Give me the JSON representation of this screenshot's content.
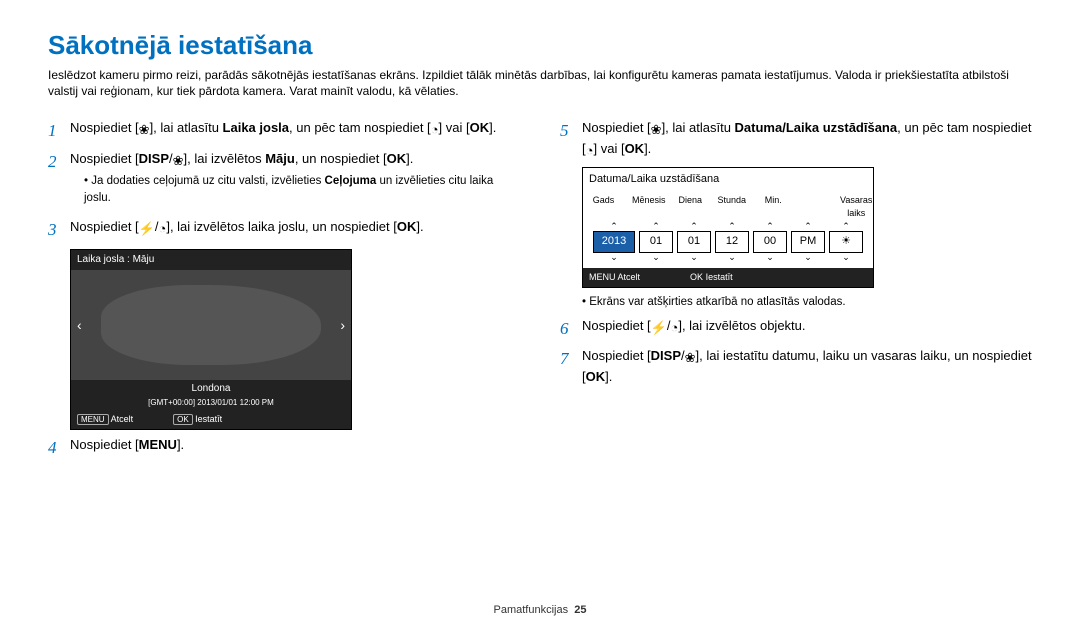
{
  "title": "Sākotnējā iestatīšana",
  "intro": "Ieslēdzot kameru pirmo reizi, parādās sākotnējās iestatīšanas ekrāns. Izpildiet tālāk minētās darbības, lai konfigurētu kameras pamata iestatījumus. Valoda ir priekšiestatīta atbilstoši valstij vai reģionam, kur tiek pārdota kamera. Varat mainīt valodu, kā vēlaties.",
  "steps": {
    "s1a": "Nospiediet [",
    "s1b": "], lai atlasītu ",
    "s1bold": "Laika josla",
    "s1c": ", un pēc tam nospiediet [",
    "s1d": "] vai [",
    "s1e": "].",
    "s2a": "Nospiediet [",
    "s2b": "], lai izvēlētos ",
    "s2bold": "Māju",
    "s2c": ", un nospiediet [",
    "s2d": "].",
    "s2suba": "Ja dodaties ceļojumā uz citu valsti, izvēlieties ",
    "s2subbold": "Ceļojuma",
    "s2subb": " un izvēlieties citu laika joslu.",
    "s3a": "Nospiediet [",
    "s3b": "], lai izvēlētos laika joslu, un nospiediet [",
    "s3c": "].",
    "s4a": "Nospiediet [",
    "s4b": "].",
    "s5a": "Nospiediet [",
    "s5b": "], lai atlasītu ",
    "s5bold": "Datuma/Laika uzstādīšana",
    "s5c": ", un pēc tam nospiediet [",
    "s5d": "] vai [",
    "s5e": "].",
    "s6a": "Nospiediet [",
    "s6b": "], lai izvēlētos objektu.",
    "s7a": "Nospiediet [",
    "s7b": "], lai iestatītu datumu, laiku un vasaras laiku, un nospiediet [",
    "s7c": "]."
  },
  "glyphs": {
    "macro": "❀",
    "timer": "◔",
    "ok": "OK",
    "disp": "DISP",
    "menu": "MENU",
    "flash": "⚡",
    "sun": "☀"
  },
  "lcd1": {
    "title": "Laika josla : Māju",
    "city": "Londona",
    "gmt": "[GMT+00:00] 2013/01/01 12:00 PM",
    "cancel": "Atcelt",
    "set": "Iestatīt"
  },
  "lcd2": {
    "title": "Datuma/Laika uzstādīšana",
    "labels": {
      "y": "Gads",
      "m": "Mēnesis",
      "d": "Diena",
      "h": "Stunda",
      "mi": "Min.",
      "dst": "Vasaras laiks"
    },
    "vals": {
      "y": "2013",
      "m": "01",
      "d": "01",
      "h": "12",
      "mi": "00",
      "ap": "PM"
    },
    "cancel": "Atcelt",
    "set": "Iestatīt"
  },
  "note": "Ekrāns var atšķirties atkarībā no atlasītās valodas.",
  "footer": {
    "section": "Pamatfunkcijas",
    "page": "25"
  }
}
